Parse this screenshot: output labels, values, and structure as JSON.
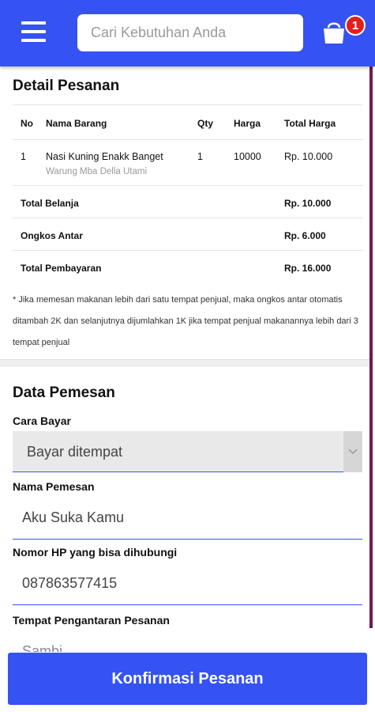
{
  "header": {
    "search_placeholder": "Cari Kebutuhan Anda",
    "cart_count": "1"
  },
  "detail": {
    "title": "Detail Pesanan",
    "columns": [
      "No",
      "Nama Barang",
      "Qty",
      "Harga",
      "Total Harga"
    ],
    "items": [
      {
        "no": "1",
        "name": "Nasi Kuning Enakk Banget",
        "shop": "Warung Mba Della Utami",
        "qty": "1",
        "price": "10000",
        "total": "Rp. 10.000"
      }
    ],
    "total_belanja_label": "Total Belanja",
    "total_belanja_value": "Rp. 10.000",
    "ongkos_label": "Ongkos Antar",
    "ongkos_value": "Rp. 6.000",
    "total_bayar_label": "Total Pembayaran",
    "total_bayar_value": "Rp. 16.000",
    "note": "* Jika memesan makanan lebih dari satu tempat penjual, maka ongkos antar otomatis ditambah 2K dan selanjutnya dijumlahkan 1K jika tempat penjual makanannya lebih dari 3 tempat penjual"
  },
  "pemesan": {
    "title": "Data Pemesan",
    "cara_bayar_label": "Cara Bayar",
    "cara_bayar_value": "Bayar ditempat",
    "nama_label": "Nama Pemesan",
    "nama_value": "Aku Suka Kamu",
    "hp_label": "Nomor HP yang bisa dihubungi",
    "hp_value": "087863577415",
    "tempat_label": "Tempat Pengantaran Pesanan",
    "tempat_value": "Sambi..."
  },
  "footer": {
    "confirm_label": "Konfirmasi Pesanan"
  },
  "colors": {
    "primary": "#3552f2",
    "badge": "#e0201e",
    "scrollbar": "#6d1a5e"
  }
}
